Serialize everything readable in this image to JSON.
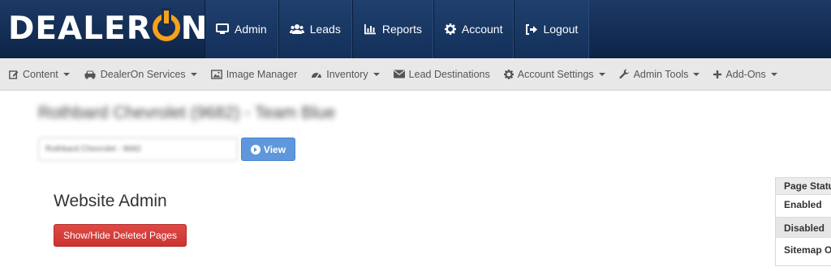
{
  "brand": {
    "logo_text_left": "DEALER",
    "logo_text_right": "N",
    "accent_color": "#f6a21c",
    "bg_color": "#132f58"
  },
  "top_nav": [
    {
      "label": "Admin",
      "icon": "monitor-icon"
    },
    {
      "label": "Leads",
      "icon": "users-icon"
    },
    {
      "label": "Reports",
      "icon": "bar-chart-icon"
    },
    {
      "label": "Account",
      "icon": "gear-icon"
    },
    {
      "label": "Logout",
      "icon": "sign-out-icon"
    }
  ],
  "sub_nav": [
    {
      "label": "Content",
      "icon": "edit-icon",
      "dropdown": true
    },
    {
      "label": "DealerOn Services",
      "icon": "car-icon",
      "dropdown": true
    },
    {
      "label": "Image Manager",
      "icon": "picture-icon",
      "dropdown": false
    },
    {
      "label": "Inventory",
      "icon": "dashboard-icon",
      "dropdown": true
    },
    {
      "label": "Lead Destinations",
      "icon": "envelope-icon",
      "dropdown": false
    },
    {
      "label": "Account Settings",
      "icon": "gear-icon",
      "dropdown": true
    },
    {
      "label": "Admin Tools",
      "icon": "wrench-icon",
      "dropdown": true
    },
    {
      "label": "Add-Ons",
      "icon": "plus-icon",
      "dropdown": true
    }
  ],
  "dealer": {
    "title": "Rothbard Chevrolet (9682) - Team Blue",
    "selector_value": "Rothbard Chevrolet - 9682",
    "view_label": "View"
  },
  "main": {
    "section_title": "Website Admin",
    "toggle_deleted_label": "Show/Hide Deleted Pages"
  },
  "status_panel": {
    "header": "Page Status",
    "rows": [
      "Enabled",
      "Disabled",
      "Sitemap Only"
    ]
  }
}
